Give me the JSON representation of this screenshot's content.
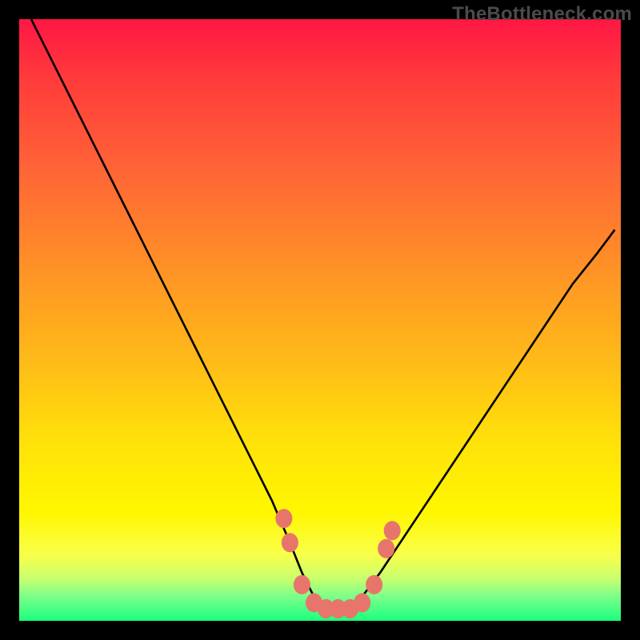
{
  "watermark": "TheBottleneck.com",
  "chart_data": {
    "type": "line",
    "title": "",
    "xlabel": "",
    "ylabel": "",
    "xlim": [
      0,
      100
    ],
    "ylim": [
      0,
      100
    ],
    "series": [
      {
        "name": "curve",
        "x": [
          2,
          6,
          10,
          14,
          18,
          22,
          26,
          30,
          34,
          38,
          42,
          45,
          47,
          49,
          51,
          53,
          55,
          57,
          60,
          64,
          68,
          72,
          76,
          80,
          84,
          88,
          92,
          96,
          99
        ],
        "y": [
          100,
          92,
          84,
          76,
          68,
          60,
          52,
          44,
          36,
          28,
          20,
          13,
          8,
          4,
          2,
          2,
          2,
          4,
          8,
          14,
          20,
          26,
          32,
          38,
          44,
          50,
          56,
          61,
          65
        ]
      }
    ],
    "markers": [
      {
        "x": 44,
        "y": 17
      },
      {
        "x": 45,
        "y": 13
      },
      {
        "x": 47,
        "y": 6
      },
      {
        "x": 49,
        "y": 3
      },
      {
        "x": 51,
        "y": 2
      },
      {
        "x": 53,
        "y": 2
      },
      {
        "x": 55,
        "y": 2
      },
      {
        "x": 57,
        "y": 3
      },
      {
        "x": 59,
        "y": 6
      },
      {
        "x": 61,
        "y": 12
      },
      {
        "x": 62,
        "y": 15
      }
    ],
    "marker_color": "#e8756b",
    "curve_color": "#000000"
  }
}
